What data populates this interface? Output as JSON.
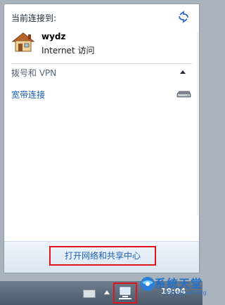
{
  "flyout": {
    "connected_to_label": "当前连接到:",
    "network": {
      "name": "wydz",
      "status": "Internet 访问"
    },
    "dialup": {
      "group_label": "拨号和 VPN",
      "connections": [
        {
          "label": "宽带连接",
          "icon": "modem-icon"
        }
      ]
    },
    "footer": {
      "open_center_label": "打开网络和共享中心"
    }
  },
  "taskbar": {
    "time": "19:04"
  },
  "watermark": {
    "text": "系统天堂",
    "sub": "XiTongTianTang"
  }
}
